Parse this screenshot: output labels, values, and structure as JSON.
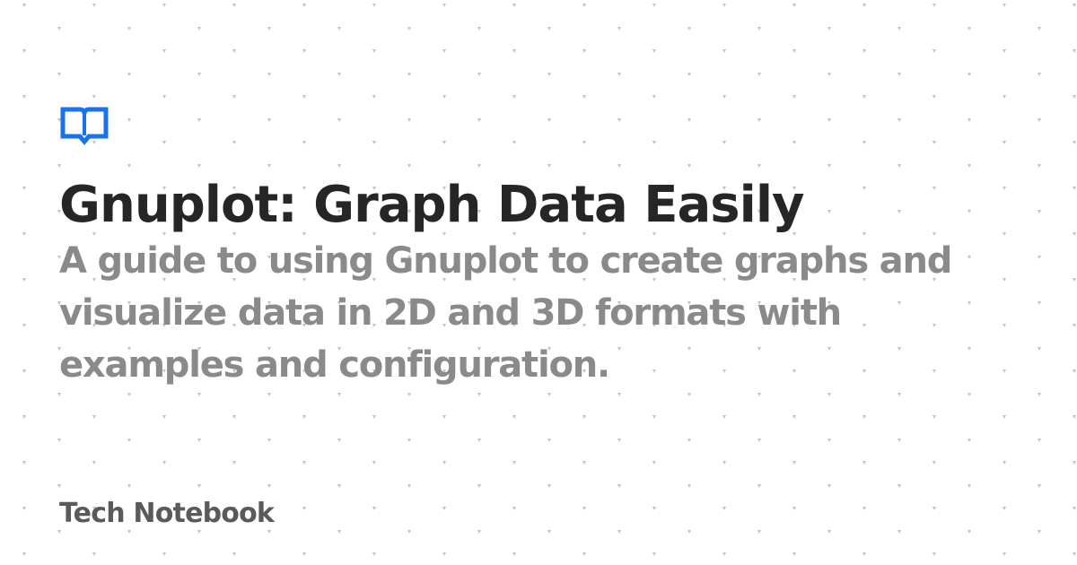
{
  "brand": {
    "accent_color": "#1a73e8",
    "logo_icon": "open-book-speech-bubble-icon"
  },
  "card": {
    "title": "Gnuplot: Graph Data Easily",
    "subtitle": "A guide to using Gnuplot to create graphs and visualize data in 2D and 3D formats with examples and configuration.",
    "site_name": "Tech Notebook"
  }
}
